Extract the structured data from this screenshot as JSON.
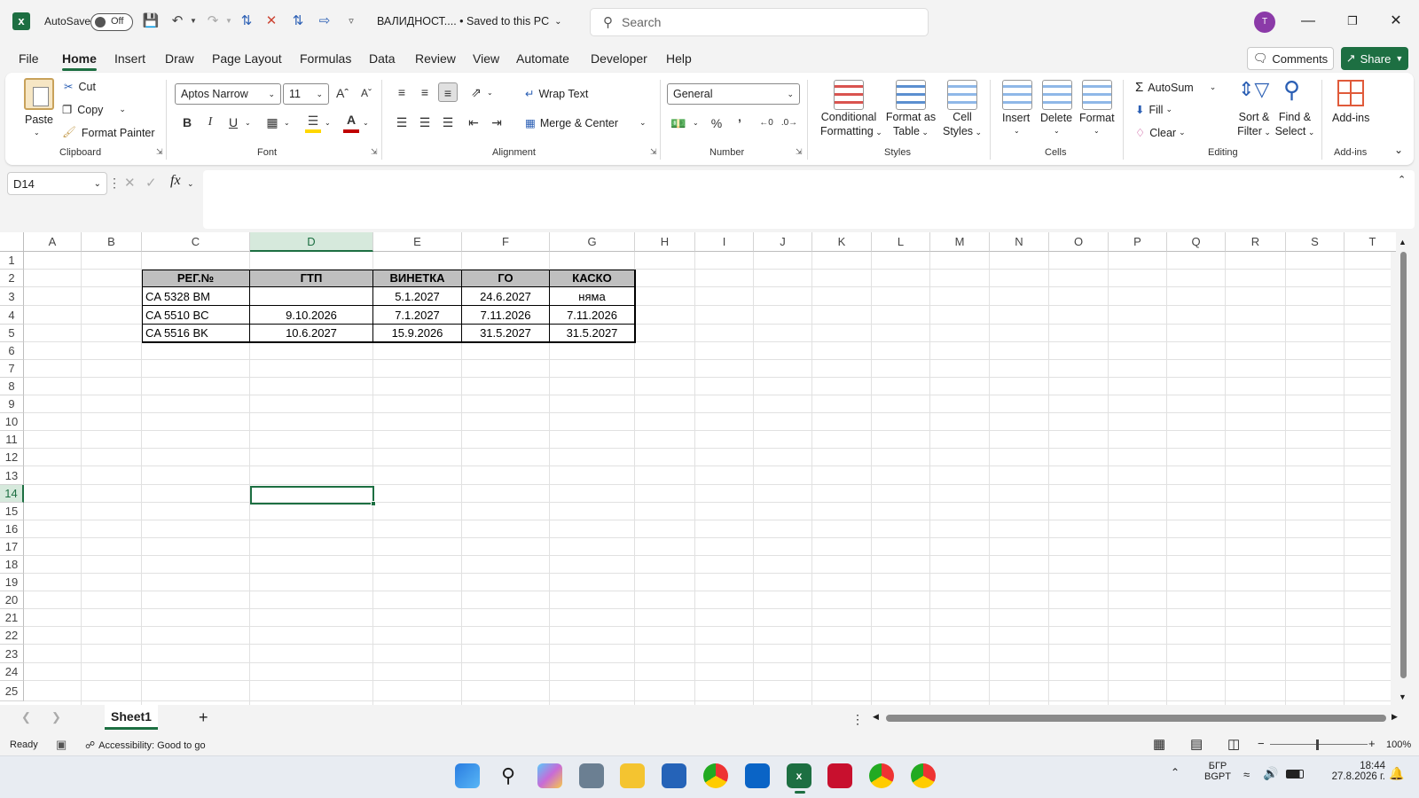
{
  "titlebar": {
    "autosave_label": "AutoSave",
    "autosave_state": "Off",
    "doc_title": "ВАЛИДНОСТ.... • Saved to this PC",
    "search_placeholder": "Search",
    "avatar_initial": "T"
  },
  "menu": {
    "items": [
      "File",
      "Home",
      "Insert",
      "Draw",
      "Page Layout",
      "Formulas",
      "Data",
      "Review",
      "View",
      "Automate",
      "Developer",
      "Help"
    ],
    "active": "Home",
    "comments_label": "Comments",
    "share_label": "Share"
  },
  "ribbon": {
    "clipboard": {
      "label": "Clipboard",
      "paste": "Paste",
      "cut": "Cut",
      "copy": "Copy",
      "format_painter": "Format Painter"
    },
    "font": {
      "label": "Font",
      "family": "Aptos Narrow",
      "size": "11",
      "bold": "B",
      "italic": "I",
      "underline": "U",
      "font_color": "#c00000",
      "fill_color": "#ffd700"
    },
    "alignment": {
      "label": "Alignment",
      "wrap_text": "Wrap Text",
      "merge_center": "Merge & Center"
    },
    "number": {
      "label": "Number",
      "format": "General"
    },
    "styles": {
      "label": "Styles",
      "conditional1": "Conditional",
      "conditional2": "Formatting",
      "format_table1": "Format as",
      "format_table2": "Table",
      "cell_styles1": "Cell",
      "cell_styles2": "Styles"
    },
    "cells": {
      "label": "Cells",
      "insert": "Insert",
      "delete": "Delete",
      "format": "Format"
    },
    "editing": {
      "label": "Editing",
      "autosum": "AutoSum",
      "fill": "Fill",
      "clear": "Clear",
      "sort1": "Sort &",
      "sort2": "Filter",
      "find1": "Find &",
      "find2": "Select"
    },
    "addins": {
      "label": "Add-ins",
      "addins": "Add-ins"
    }
  },
  "formula_bar": {
    "name_box": "D14",
    "fx": "fx",
    "content": ""
  },
  "columns": [
    "A",
    "B",
    "C",
    "D",
    "E",
    "F",
    "G",
    "H",
    "I",
    "J",
    "K",
    "L",
    "M",
    "N",
    "O",
    "P",
    "Q",
    "R",
    "S",
    "T"
  ],
  "rows": [
    "1",
    "2",
    "3",
    "4",
    "5",
    "6",
    "7",
    "8",
    "9",
    "10",
    "11",
    "12",
    "13",
    "14",
    "15",
    "16",
    "17",
    "18",
    "19",
    "20",
    "21",
    "22",
    "23",
    "24",
    "25"
  ],
  "table": {
    "headers": [
      "РЕГ.№",
      "ГТП",
      "ВИНЕТКА",
      "ГО",
      "КАСКО"
    ],
    "rows": [
      [
        "CA 5328 BM",
        "",
        "5.1.2027",
        "24.6.2027",
        "няма"
      ],
      [
        "CA 5510 BC",
        "9.10.2026",
        "7.1.2027",
        "7.11.2026",
        "7.11.2026"
      ],
      [
        "CA 5516 BK",
        "10.6.2027",
        "15.9.2026",
        "31.5.2027",
        "31.5.2027"
      ]
    ]
  },
  "selected_cell": "D14",
  "sheets": {
    "tabs": [
      "Sheet1"
    ],
    "active": "Sheet1",
    "add": "+"
  },
  "status": {
    "ready": "Ready",
    "accessibility": "Accessibility: Good to go",
    "zoom": "100%"
  },
  "taskbar": {
    "lang1": "БГР",
    "lang2": "BGPT",
    "time": "18:44",
    "date": "27.8.2026 г."
  },
  "colors": {
    "excel_green": "#1d6f42",
    "header_fill": "#bfbfbf",
    "avatar": "#8b3aa8"
  }
}
